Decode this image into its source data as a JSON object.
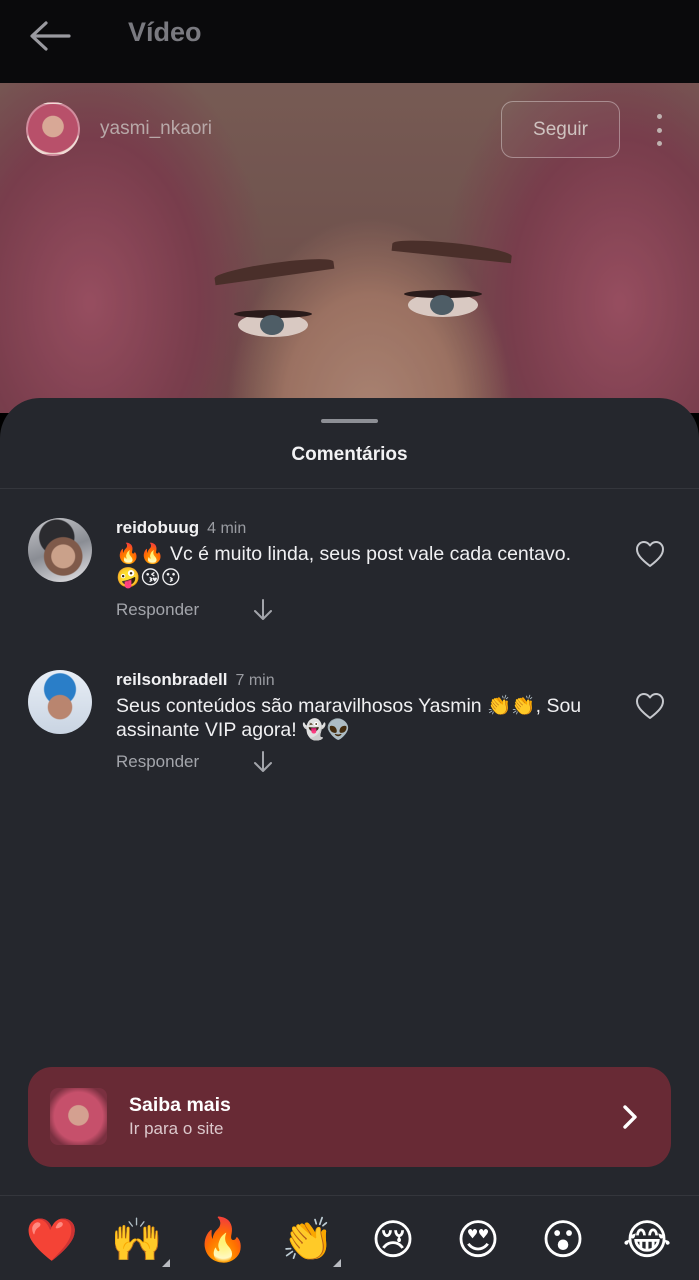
{
  "topbar": {
    "title": "Vídeo"
  },
  "video": {
    "uploader_name": "yasmi_nkaori",
    "follow_label": "Seguir"
  },
  "comments_sheet": {
    "title": "Comentários",
    "comments": [
      {
        "user": "reidobuug",
        "time": "4 min",
        "text": "🔥🔥 Vc é muito linda, seus post vale cada centavo. 🤪😘😗",
        "reply_label": "Responder"
      },
      {
        "user": "reilsonbradell",
        "time": "7 min",
        "text": "Seus conteúdos são maravilhosos Yasmin 👏👏, Sou assinante VIP agora! 👻👽",
        "reply_label": "Responder"
      }
    ]
  },
  "cta": {
    "title": "Saiba mais",
    "subtitle": "Ir para o site"
  },
  "reactions": [
    "❤️",
    "🙌",
    "🔥",
    "👏",
    "😢",
    "😍",
    "😮",
    "😂"
  ],
  "colors": {
    "sheet_bg": "#25272d",
    "cta_bg": "#682a35",
    "topbar_bg": "#0a0a0c"
  }
}
